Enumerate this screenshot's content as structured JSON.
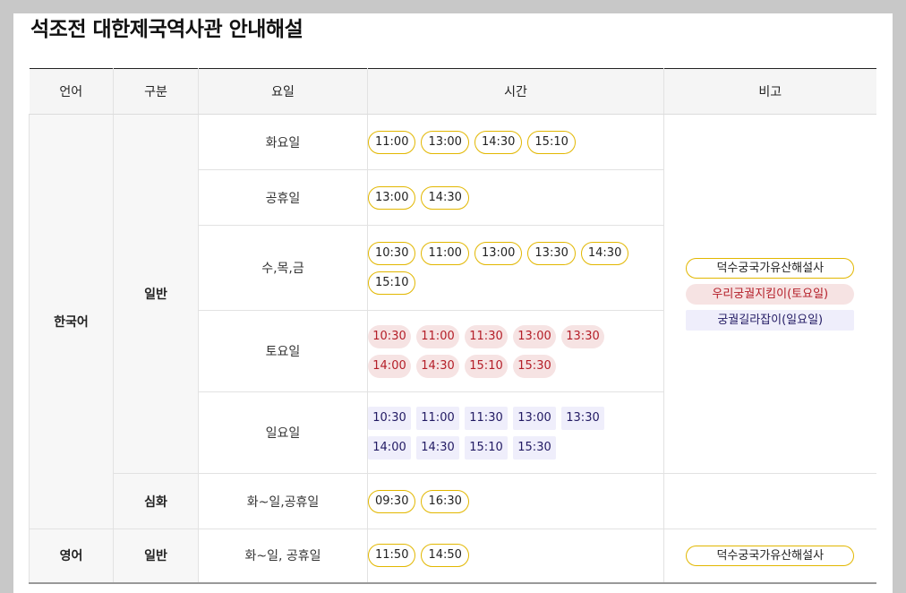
{
  "title": "석조전 대한제국역사관 안내해설",
  "headers": {
    "language": "언어",
    "category": "구분",
    "day": "요일",
    "time": "시간",
    "note": "비고"
  },
  "colors": {
    "yellow_border": "#e2b700",
    "pink_bg": "#f6e3e3",
    "pink_text": "#b41e28",
    "lavender_bg": "#efeefb",
    "lavender_text": "#221a63"
  },
  "korean": {
    "language": "한국어",
    "general": {
      "category": "일반",
      "rows": [
        {
          "day": "화요일",
          "style": "yellow",
          "times": [
            "11:00",
            "13:00",
            "14:30",
            "15:10"
          ]
        },
        {
          "day": "공휴일",
          "style": "yellow",
          "times": [
            "13:00",
            "14:30"
          ]
        },
        {
          "day": "수,목,금",
          "style": "yellow",
          "times": [
            "10:30",
            "11:00",
            "13:00",
            "13:30",
            "14:30",
            "15:10"
          ]
        },
        {
          "day": "토요일",
          "style": "pink",
          "times": [
            "10:30",
            "11:00",
            "11:30",
            "13:00",
            "13:30",
            "14:00",
            "14:30",
            "15:10",
            "15:30"
          ]
        },
        {
          "day": "일요일",
          "style": "lavender",
          "times": [
            "10:30",
            "11:00",
            "11:30",
            "13:00",
            "13:30",
            "14:00",
            "14:30",
            "15:10",
            "15:30"
          ]
        }
      ],
      "notes": [
        {
          "label": "덕수궁국가유산해설사",
          "style": "yellow"
        },
        {
          "label": "우리궁궐지킴이(토요일)",
          "style": "pink"
        },
        {
          "label": "궁궐길라잡이(일요일)",
          "style": "lavender"
        }
      ]
    },
    "advanced": {
      "category": "심화",
      "day": "화~일,공휴일",
      "style": "yellow",
      "times": [
        "09:30",
        "16:30"
      ]
    }
  },
  "english": {
    "language": "영어",
    "category": "일반",
    "day": "화~일, 공휴일",
    "style": "yellow",
    "times": [
      "11:50",
      "14:50"
    ],
    "notes": [
      {
        "label": "덕수궁국가유산해설사",
        "style": "yellow"
      }
    ]
  }
}
